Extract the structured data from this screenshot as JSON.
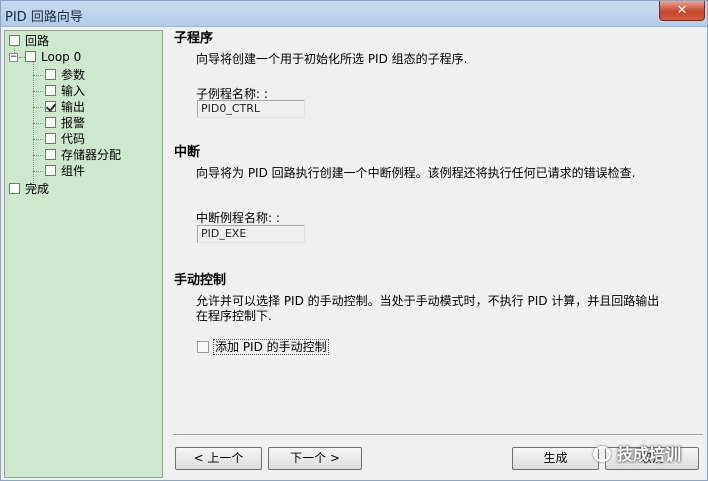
{
  "window": {
    "title": "PID 回路向导",
    "close_label": "✕"
  },
  "tree": {
    "items": [
      {
        "label": "回路",
        "checked": false
      },
      {
        "label": "Loop 0",
        "checked": false
      },
      {
        "label": "参数",
        "checked": false
      },
      {
        "label": "输入",
        "checked": false
      },
      {
        "label": "输出",
        "checked": true
      },
      {
        "label": "报警",
        "checked": false
      },
      {
        "label": "代码",
        "checked": false
      },
      {
        "label": "存储器分配",
        "checked": false
      },
      {
        "label": "组件",
        "checked": false
      },
      {
        "label": "完成",
        "checked": false
      }
    ],
    "expander_symbol": "−"
  },
  "subroutine": {
    "title": "子程序",
    "description": "向导将创建一个用于初始化所选 PID 组态的子程序.",
    "field_label": "子例程名称: :",
    "field_value": "PID0_CTRL"
  },
  "interrupt": {
    "title": "中断",
    "description": "向导将为 PID 回路执行创建一个中断例程。该例程还将执行任何已请求的错误检查.",
    "field_label": "中断例程名称: :",
    "field_value": "PID_EXE"
  },
  "manual": {
    "title": "手动控制",
    "description_line1": "允许并可以选择 PID 的手动控制。当处于手动模式时，不执行 PID 计算，并且回路输出",
    "description_line2": "在程序控制下.",
    "checkbox_label": "添加 PID 的手动控制",
    "checkbox_checked": false
  },
  "buttons": {
    "prev": "< 上一个",
    "next": "下一个 >",
    "finish": "生成",
    "cancel": "取消"
  },
  "watermark": {
    "text": "技成培训"
  }
}
